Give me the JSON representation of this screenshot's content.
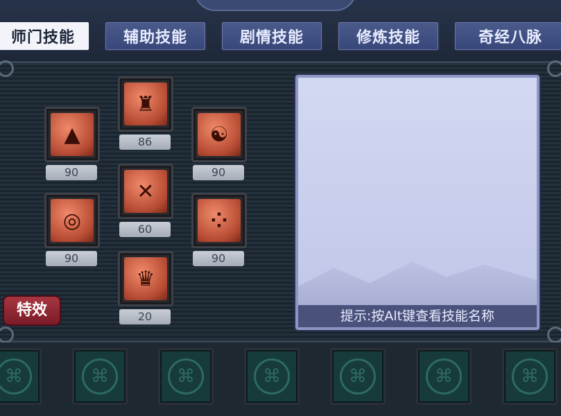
{
  "tabs": [
    {
      "label": "师门技能",
      "active": true
    },
    {
      "label": "辅助技能",
      "active": false
    },
    {
      "label": "剧情技能",
      "active": false
    },
    {
      "label": "修炼技能",
      "active": false
    },
    {
      "label": "奇经八脉",
      "active": false
    }
  ],
  "skills": [
    {
      "icon": "buddha-shrine-icon",
      "level": "90"
    },
    {
      "icon": "horned-helm-icon",
      "level": "86"
    },
    {
      "icon": "beast-head-icon",
      "level": "90"
    },
    {
      "icon": "crossed-blades-icon",
      "level": "60"
    },
    {
      "icon": "sun-rune-icon",
      "level": "90"
    },
    {
      "icon": "dotted-seal-icon",
      "level": "90"
    },
    {
      "icon": "spiked-gate-icon",
      "level": "20"
    }
  ],
  "effect_button": "特效",
  "info_panel": {
    "hint": "提示:按Alt键查看技能名称"
  },
  "slots": {
    "count": 7,
    "icon": "lattice-knot-icon"
  },
  "colors": {
    "tab_bg": "#4a5a8a",
    "tab_active_bg": "#f2f4fa",
    "skill_icon": "#c85a3c",
    "effect_btn": "#8e2430",
    "info_bg": "#cdd2ee"
  }
}
